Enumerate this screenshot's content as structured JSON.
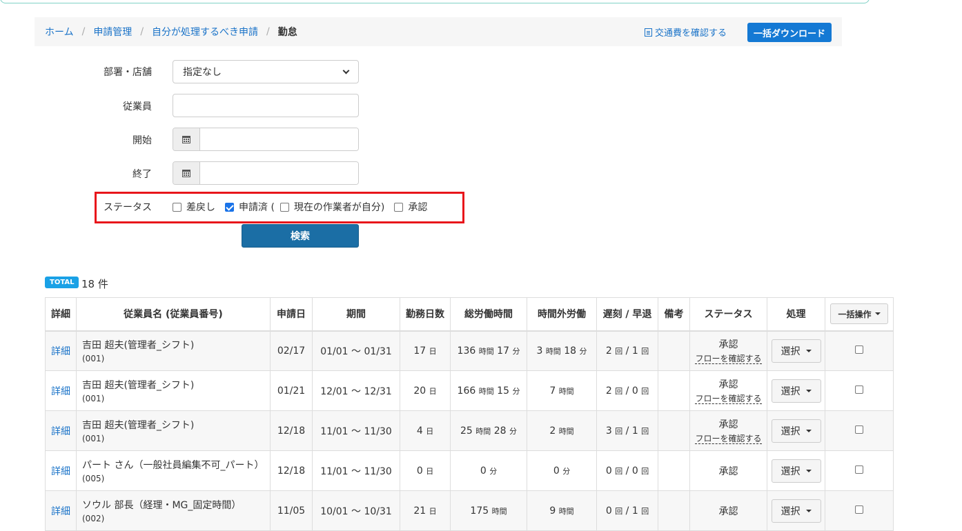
{
  "breadcrumb": {
    "items": [
      "ホーム",
      "申請管理",
      "自分が処理するべき申請"
    ],
    "separator": "/",
    "current": "勤怠"
  },
  "header": {
    "kotsuhi_link": "交通費を確認する",
    "download_button": "一括ダウンロード"
  },
  "form": {
    "department_label": "部署・店舗",
    "department_value": "指定なし",
    "employee_label": "従業員",
    "start_label": "開始",
    "end_label": "終了",
    "status_label": "ステータス",
    "status_options": [
      {
        "label": "差戻し",
        "checked": false
      },
      {
        "label": "申請済 (",
        "checked": true
      },
      {
        "label": "現在の作業者が自分)",
        "checked": false
      },
      {
        "label": "承認",
        "checked": false
      }
    ],
    "search_button": "検索"
  },
  "total": {
    "badge": "TOTAL",
    "count": "18 件"
  },
  "table": {
    "headers": [
      "詳細",
      "従業員名 (従業員番号)",
      "申請日",
      "期間",
      "勤務日数",
      "総労働時間",
      "時間外労働",
      "遅刻 / 早退",
      "備考",
      "ステータス",
      "処理",
      "一括操作"
    ],
    "detail_link": "詳細",
    "select_label": "選択",
    "flow_link": "フローを確認する",
    "rows": [
      {
        "name": "吉田 超夫(管理者_シフト)",
        "number": "(001)",
        "date": "02/17",
        "period": "01/01 〜 01/31",
        "days": "17",
        "days_unit": "日",
        "total_h": "136",
        "total_h_unit": "時間",
        "total_m": "17",
        "total_m_unit": "分",
        "over_h": "3",
        "over_h_unit": "時間",
        "over_m": "18",
        "over_m_unit": "分",
        "late": "2",
        "late_unit": "回",
        "early": "1",
        "early_unit": "回",
        "remark": "",
        "status": "承認",
        "flow": true
      },
      {
        "name": "吉田 超夫(管理者_シフト)",
        "number": "(001)",
        "date": "01/21",
        "period": "12/01 〜 12/31",
        "days": "20",
        "days_unit": "日",
        "total_h": "166",
        "total_h_unit": "時間",
        "total_m": "15",
        "total_m_unit": "分",
        "over_h": "7",
        "over_h_unit": "時間",
        "over_m": "",
        "over_m_unit": "",
        "late": "2",
        "late_unit": "回",
        "early": "0",
        "early_unit": "回",
        "remark": "",
        "status": "承認",
        "flow": true
      },
      {
        "name": "吉田 超夫(管理者_シフト)",
        "number": "(001)",
        "date": "12/18",
        "period": "11/01 〜 11/30",
        "days": "4",
        "days_unit": "日",
        "total_h": "25",
        "total_h_unit": "時間",
        "total_m": "28",
        "total_m_unit": "分",
        "over_h": "2",
        "over_h_unit": "時間",
        "over_m": "",
        "over_m_unit": "",
        "late": "3",
        "late_unit": "回",
        "early": "1",
        "early_unit": "回",
        "remark": "",
        "status": "承認",
        "flow": true
      },
      {
        "name": "パート さん（一般社員編集不可_パート）",
        "number": "(005)",
        "date": "12/18",
        "period": "11/01 〜 11/30",
        "days": "0",
        "days_unit": "日",
        "total_h": "",
        "total_h_unit": "",
        "total_m": "0",
        "total_m_unit": "分",
        "over_h": "",
        "over_h_unit": "",
        "over_m": "0",
        "over_m_unit": "分",
        "late": "0",
        "late_unit": "回",
        "early": "0",
        "early_unit": "回",
        "remark": "",
        "status": "承認",
        "flow": false
      },
      {
        "name": "ソウル 部長（経理・MG_固定時間）",
        "number": "(002)",
        "date": "11/05",
        "period": "10/01 〜 10/31",
        "days": "21",
        "days_unit": "日",
        "total_h": "175",
        "total_h_unit": "時間",
        "total_m": "",
        "total_m_unit": "",
        "over_h": "9",
        "over_h_unit": "時間",
        "over_m": "",
        "over_m_unit": "",
        "late": "0",
        "late_unit": "回",
        "early": "1",
        "early_unit": "回",
        "remark": "",
        "status": "承認",
        "flow": false
      }
    ]
  }
}
